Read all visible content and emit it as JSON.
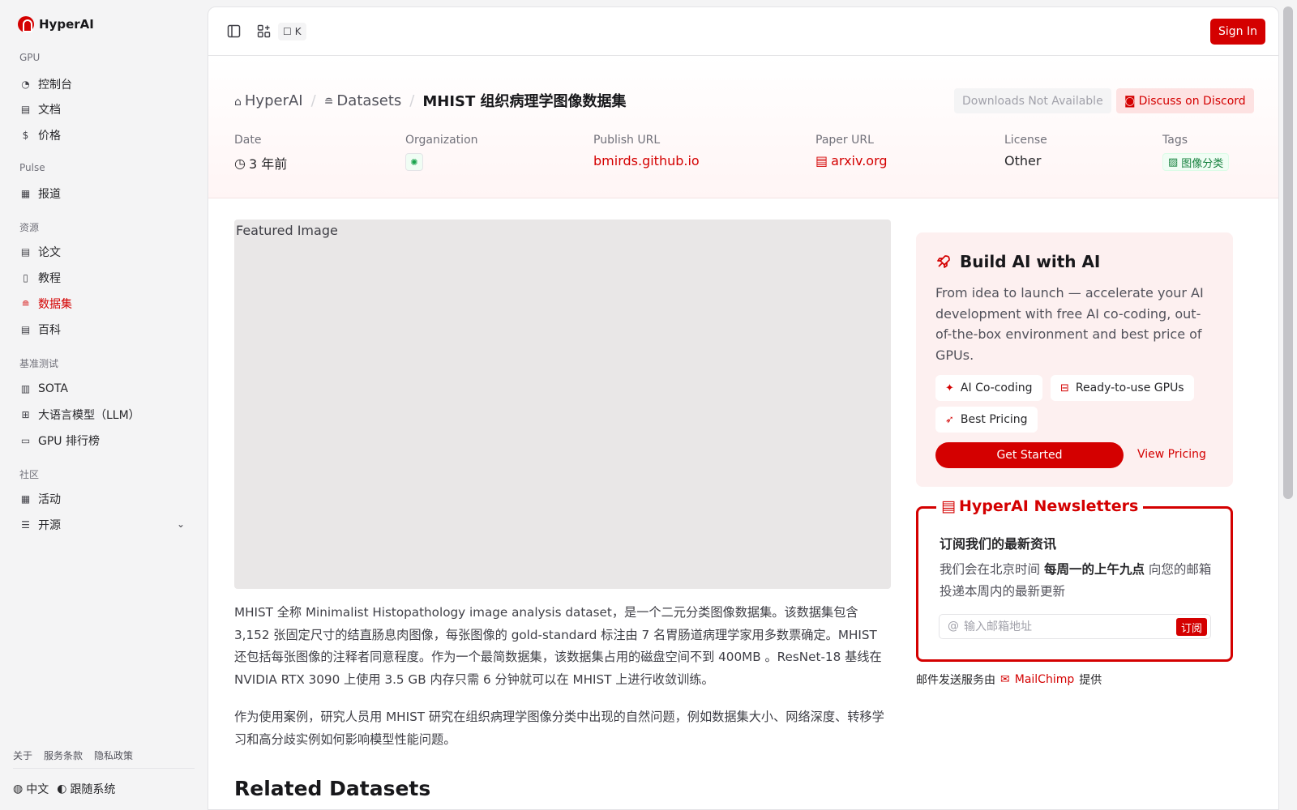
{
  "brand": {
    "name": "HyperAI"
  },
  "sidebar": {
    "sections": [
      {
        "label": "GPU",
        "items": [
          {
            "label": "控制台",
            "icon": "gauge-icon"
          },
          {
            "label": "文档",
            "icon": "doc-icon"
          },
          {
            "label": "价格",
            "icon": "dollar-icon"
          }
        ]
      },
      {
        "label": "Pulse",
        "items": [
          {
            "label": "报道",
            "icon": "newspaper-icon"
          }
        ]
      },
      {
        "label": "资源",
        "items": [
          {
            "label": "论文",
            "icon": "paper-icon"
          },
          {
            "label": "教程",
            "icon": "book-icon"
          },
          {
            "label": "数据集",
            "icon": "database-icon",
            "active": true
          },
          {
            "label": "百科",
            "icon": "wiki-icon"
          }
        ]
      },
      {
        "label": "基准测试",
        "items": [
          {
            "label": "SOTA",
            "icon": "bar-chart-icon"
          },
          {
            "label": "大语言模型（LLM）",
            "icon": "cpu-icon"
          },
          {
            "label": "GPU 排行榜",
            "icon": "monitor-icon"
          }
        ]
      },
      {
        "label": "社区",
        "items": [
          {
            "label": "活动",
            "icon": "calendar-icon"
          },
          {
            "label": "开源",
            "icon": "list-icon"
          }
        ]
      }
    ],
    "footer_links": [
      "关于",
      "服务条款",
      "隐私政策"
    ],
    "language": "中文",
    "theme": "跟随系统"
  },
  "topbar": {
    "kbd": "K",
    "signin": "Sign In"
  },
  "breadcrumb": {
    "home": "HyperAI",
    "section": "Datasets",
    "current": "MHIST 组织病理学图像数据集"
  },
  "actions": {
    "downloads": "Downloads Not Available",
    "discord": "Discuss on Discord"
  },
  "meta": {
    "date_label": "Date",
    "date_value": "3 年前",
    "org_label": "Organization",
    "publish_label": "Publish URL",
    "publish_value": "bmirds.github.io",
    "paper_label": "Paper URL",
    "paper_value": "arxiv.org",
    "license_label": "License",
    "license_value": "Other",
    "tags_label": "Tags",
    "tag_value": "图像分类"
  },
  "featured_alt": "Featured Image",
  "description": [
    "MHIST 全称 Minimalist Histopathology image analysis dataset，是一个二元分类图像数据集。该数据集包含 3,152 张固定尺寸的结直肠息肉图像，每张图像的 gold-standard 标注由 7 名胃肠道病理学家用多数票确定。MHIST 还包括每张图像的注释者同意程度。作为一个最简数据集，该数据集占用的磁盘空间不到 400MB 。ResNet-18 基线在 NVIDIA RTX 3090 上使用 3.5 GB 内存只需 6 分钟就可以在 MHIST 上进行收敛训练。",
    "作为使用案例，研究人员用 MHIST 研究在组织病理学图像分类中出现的自然问题，例如数据集大小、网络深度、转移学习和高分歧实例如何影响模型性能问题。"
  ],
  "related_title": "Related Datasets",
  "promo": {
    "title": "Build AI with AI",
    "body": "From idea to launch — accelerate your AI development with free AI co-coding, out-of-the-box environment and best price of GPUs.",
    "pills": [
      "AI Co-coding",
      "Ready-to-use GPUs",
      "Best Pricing"
    ],
    "cta": "Get Started",
    "link": "View Pricing"
  },
  "newsletter": {
    "title": "HyperAI Newsletters",
    "subtitle": "订阅我们的最新资讯",
    "text_a": "我们会在北京时间 ",
    "text_b": "每周一的上午九点",
    "text_c": " 向您的邮箱投递本周内的最新更新",
    "placeholder": "输入邮箱地址",
    "button": "订阅",
    "provider_pre": "邮件发送服务由",
    "provider": "MailChimp",
    "provider_post": "提供"
  },
  "colors": {
    "accent": "#d40000"
  }
}
